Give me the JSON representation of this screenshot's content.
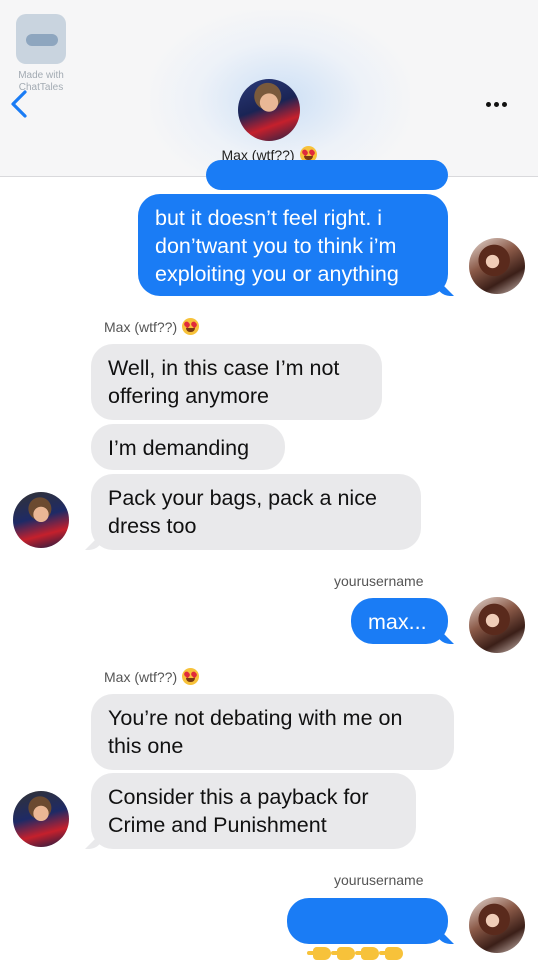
{
  "watermark": {
    "line1": "Made with",
    "line2": "ChatTales"
  },
  "header": {
    "contact_name": "Max (wtf??)",
    "contact_emoji": "heart-eyes",
    "back_icon": "chevron-left-icon",
    "more_icon": "more-horizontal-icon"
  },
  "colors": {
    "outgoing_bubble": "#1a7cf5",
    "incoming_bubble": "#e9e9eb",
    "back_icon": "#1a7cf5"
  },
  "messages": [
    {
      "direction": "out",
      "text": "but it doesn’t feel right. i\ndon’twant you to think i’m\nexploiting you or anything"
    },
    {
      "sender": "Max (wtf??)",
      "direction": "in",
      "text": "Well, in this case I’m not\noffering anymore"
    },
    {
      "direction": "in",
      "text": "I’m demanding"
    },
    {
      "direction": "in",
      "text": "Pack your bags, pack a nice\ndress too"
    },
    {
      "sender": "yourusername",
      "direction": "out",
      "text": "max..."
    },
    {
      "sender": "Max (wtf??)",
      "direction": "in",
      "text": "You’re not debating with me on\nthis one"
    },
    {
      "direction": "in",
      "text": "Consider this a payback for\nCrime and Punishment"
    },
    {
      "sender": "yourusername",
      "direction": "out",
      "text": "",
      "emoji_content": "four backhand-index-pointing-left emojis"
    }
  ]
}
